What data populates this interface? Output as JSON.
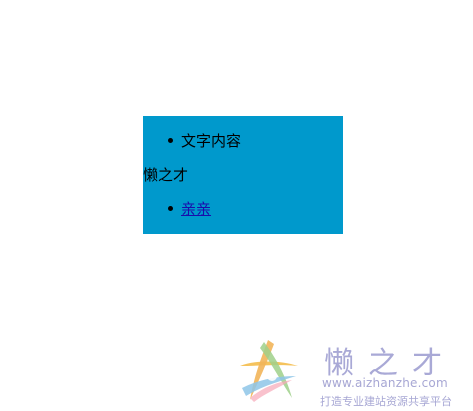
{
  "box": {
    "background": "#0099cc",
    "item1_text": "文字内容",
    "plain_text": "懒之才",
    "link_text": "亲亲"
  },
  "watermark": {
    "title": "懒之才",
    "url": "www.aizhanzhe.com",
    "slogan": "打造专业建站资源共享平台",
    "logo_icon": "star-swirl-logo"
  }
}
